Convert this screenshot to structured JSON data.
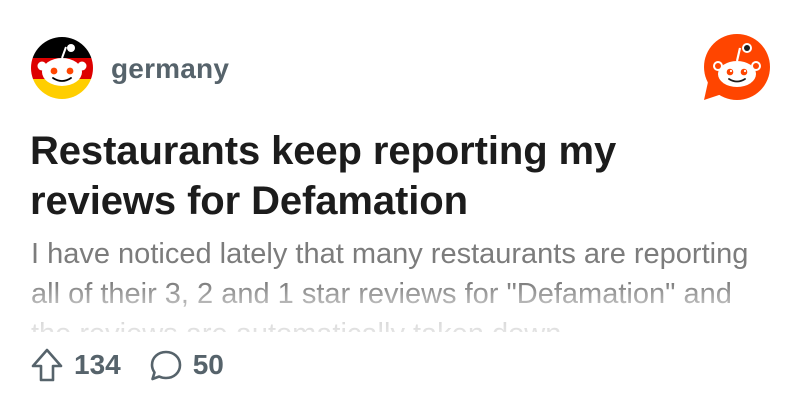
{
  "subreddit": {
    "name": "germany",
    "avatar_icon": "germany-flag-snoo-icon",
    "flag_colors": [
      "#000000",
      "#DD0000",
      "#FFCE00"
    ]
  },
  "brand": {
    "logo_icon": "reddit-logo-icon",
    "color": "#FF4500"
  },
  "post": {
    "title": "Restaurants keep reporting my reviews for Defamation",
    "body": "I have noticed lately that many restaurants are reporting all of their 3, 2 and 1 star reviews for \"Defamation\" and the reviews are automatically taken down"
  },
  "stats": {
    "upvotes": "134",
    "upvote_icon": "upvote-arrow-icon",
    "comments": "50",
    "comment_icon": "comment-bubble-icon"
  }
}
